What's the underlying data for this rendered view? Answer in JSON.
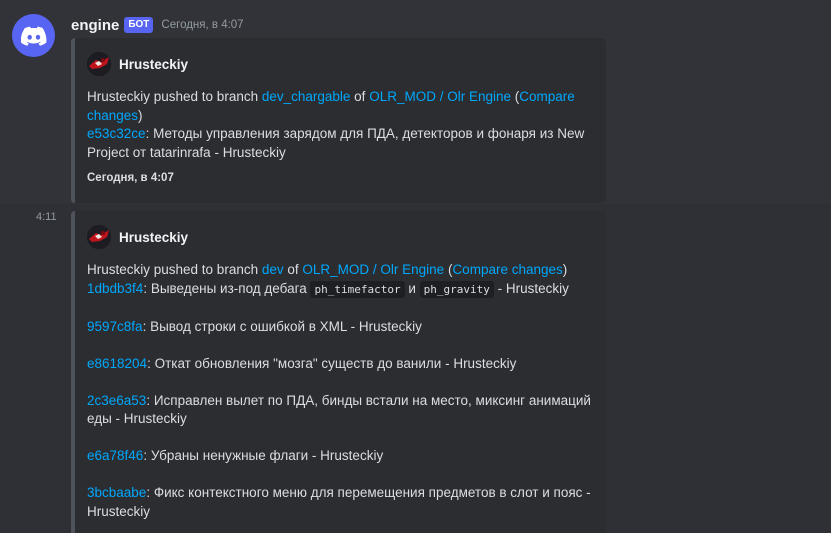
{
  "bot": {
    "username": "engine",
    "tag": "БОТ",
    "timestamp": "Сегодня, в 4:07",
    "avatar_icon": "discord-logo-icon"
  },
  "embed1": {
    "author": "Hrusteckiy",
    "line1_pre": "Hrusteckiy pushed to branch ",
    "branch": "dev_chargable",
    "of": " of ",
    "repo": "OLR_MOD / Olr Engine",
    "paren_open": " (",
    "compare": "Compare changes",
    "paren_close": ")",
    "commit_hash": "e53c32ce",
    "commit_text": ": Методы управления зарядом для ПДА, детекторов и фонаря из New Project от tatarinrafa - Hrusteckiy",
    "footer": "Сегодня, в 4:07"
  },
  "msg2": {
    "side_time": "4:11",
    "embed": {
      "author": "Hrusteckiy",
      "line1_pre": "Hrusteckiy pushed to branch ",
      "branch": "dev",
      "of": " of ",
      "repo": "OLR_MOD / Olr Engine",
      "paren_open": " (",
      "compare": "Compare changes",
      "paren_close": ")",
      "commits": [
        {
          "hash": "1dbdb3f4",
          "pre": ": Выведены из-под дебага ",
          "code1": "ph_timefactor",
          "mid": " и ",
          "code2": "ph_gravity",
          "post": " - Hrusteckiy"
        },
        {
          "hash": "9597c8fa",
          "text": ": Вывод строки с ошибкой в XML - Hrusteckiy"
        },
        {
          "hash": "e8618204",
          "text": ": Откат обновления \"мозга\" существ до ванили - Hrusteckiy"
        },
        {
          "hash": "2c3e6a53",
          "text": ": Исправлен вылет по ПДА, бинды встали на место, миксинг анимаций еды - Hrusteckiy"
        },
        {
          "hash": "e6a78f46",
          "text": ": Убраны ненужные флаги - Hrusteckiy"
        },
        {
          "hash": "3bcbaabe",
          "text": ": Фикс контекстного меню для перемещения предметов в слот и пояс - Hrusteckiy"
        }
      ]
    }
  }
}
